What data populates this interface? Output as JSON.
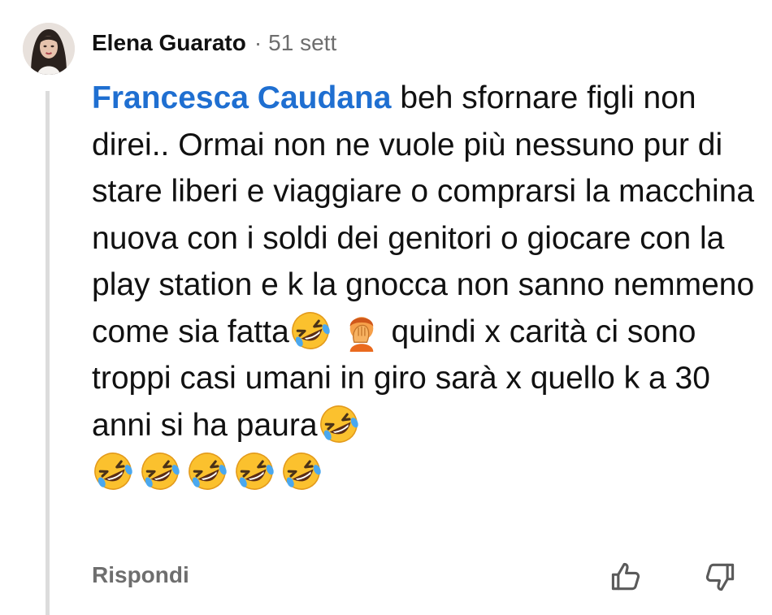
{
  "comment": {
    "author": "Elena Guarato",
    "separator": "·",
    "time_ago": "51 sett",
    "mention": "Francesca Caudana",
    "text_part_1": " beh sfornare figli non direi.. Ormai non ne vuole più nessuno pur di stare liberi e viaggiare o comprarsi la macchina nuova con i soldi dei genitori o giocare con la play station e k la gnocca non sanno nemmeno come sia fatta",
    "text_part_2": " quindi x carità ci sono troppi casi umani in giro sarà x quello k a 30 anni si ha paura",
    "emojis": [
      "rolling-on-floor-laughing",
      "person-facepalming",
      "rolling-on-floor-laughing"
    ],
    "trailing_emoji_count": 5
  },
  "actions": {
    "reply_label": "Rispondi",
    "upvote_icon": "thumbs-up-icon",
    "downvote_icon": "thumbs-down-icon"
  },
  "colors": {
    "mention": "#1f6fd1",
    "meta_text": "#6e6e6e",
    "thread_line": "#dcdcdc"
  }
}
